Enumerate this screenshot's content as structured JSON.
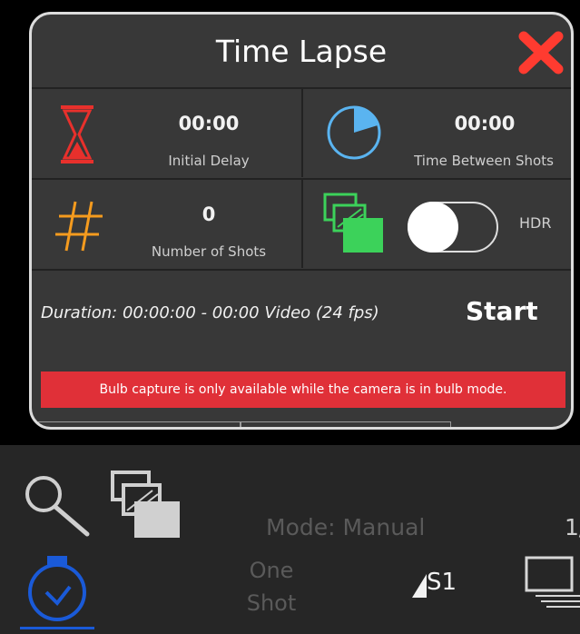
{
  "modal": {
    "title": "Time Lapse",
    "initial_delay": {
      "value": "00:00",
      "label": "Initial Delay"
    },
    "time_between_shots": {
      "value": "00:00",
      "label": "Time Between Shots"
    },
    "number_of_shots": {
      "value": "0",
      "label": "Number of Shots"
    },
    "hdr": {
      "label": "HDR",
      "enabled": false
    },
    "duration_text": "Duration: 00:00:00 - 00:00 Video (24 fps)",
    "start_label": "Start",
    "error_message": "Bulb capture is only available while the camera is in bulb mode."
  },
  "bottom_bar": {
    "mode_text": "Mode: Manual",
    "shutter_partial": "1/",
    "drive_line1": "One",
    "drive_line2": "Shot",
    "slot_label": "S1"
  },
  "colors": {
    "accent_red": "#e03038",
    "close_red": "#ff3b30",
    "hourglass_red": "#e8302c",
    "timer_blue": "#5ab4f0",
    "hash_orange": "#f59b1e",
    "hdr_green": "#3cd25a",
    "nav_blue": "#1a5ad8"
  },
  "icons": [
    "hourglass-icon",
    "pie-timer-icon",
    "hash-icon",
    "hdr-frames-icon",
    "close-icon",
    "search-icon",
    "frames-icon",
    "stopwatch-icon",
    "bars-icon",
    "monitor-icon"
  ]
}
